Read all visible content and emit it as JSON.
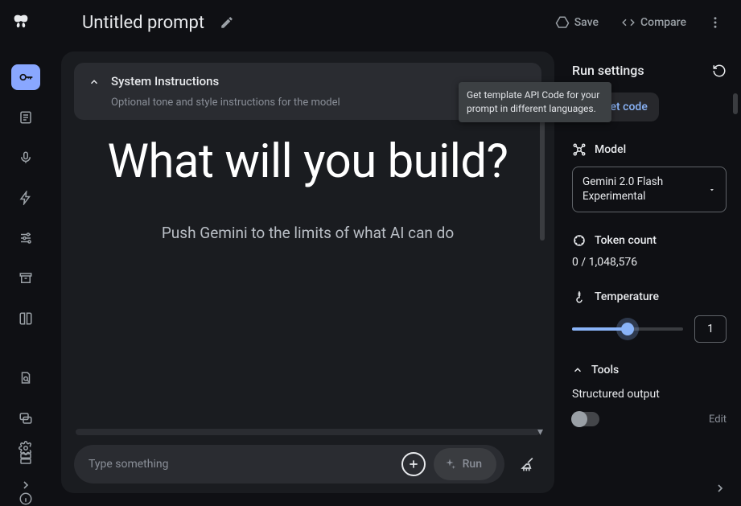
{
  "header": {
    "title": "Untitled prompt",
    "save_label": "Save",
    "compare_label": "Compare"
  },
  "system_instructions": {
    "title": "System Instructions",
    "subtitle": "Optional tone and style instructions for the model"
  },
  "tooltip": {
    "text": "Get template API Code for your prompt in different languages."
  },
  "hero": {
    "title": "What will you build?",
    "subtitle": "Push Gemini to the limits of what AI can do"
  },
  "input": {
    "placeholder": "Type something",
    "run_label": "Run"
  },
  "run_settings": {
    "title": "Run settings",
    "get_code_label": "Get code",
    "model_label": "Model",
    "model_value": "Gemini 2.0 Flash Experimental",
    "token_label": "Token count",
    "token_value": "0 / 1,048,576",
    "temperature_label": "Temperature",
    "temperature_value": "1",
    "tools_label": "Tools",
    "structured_output_label": "Structured output",
    "edit_label": "Edit"
  }
}
